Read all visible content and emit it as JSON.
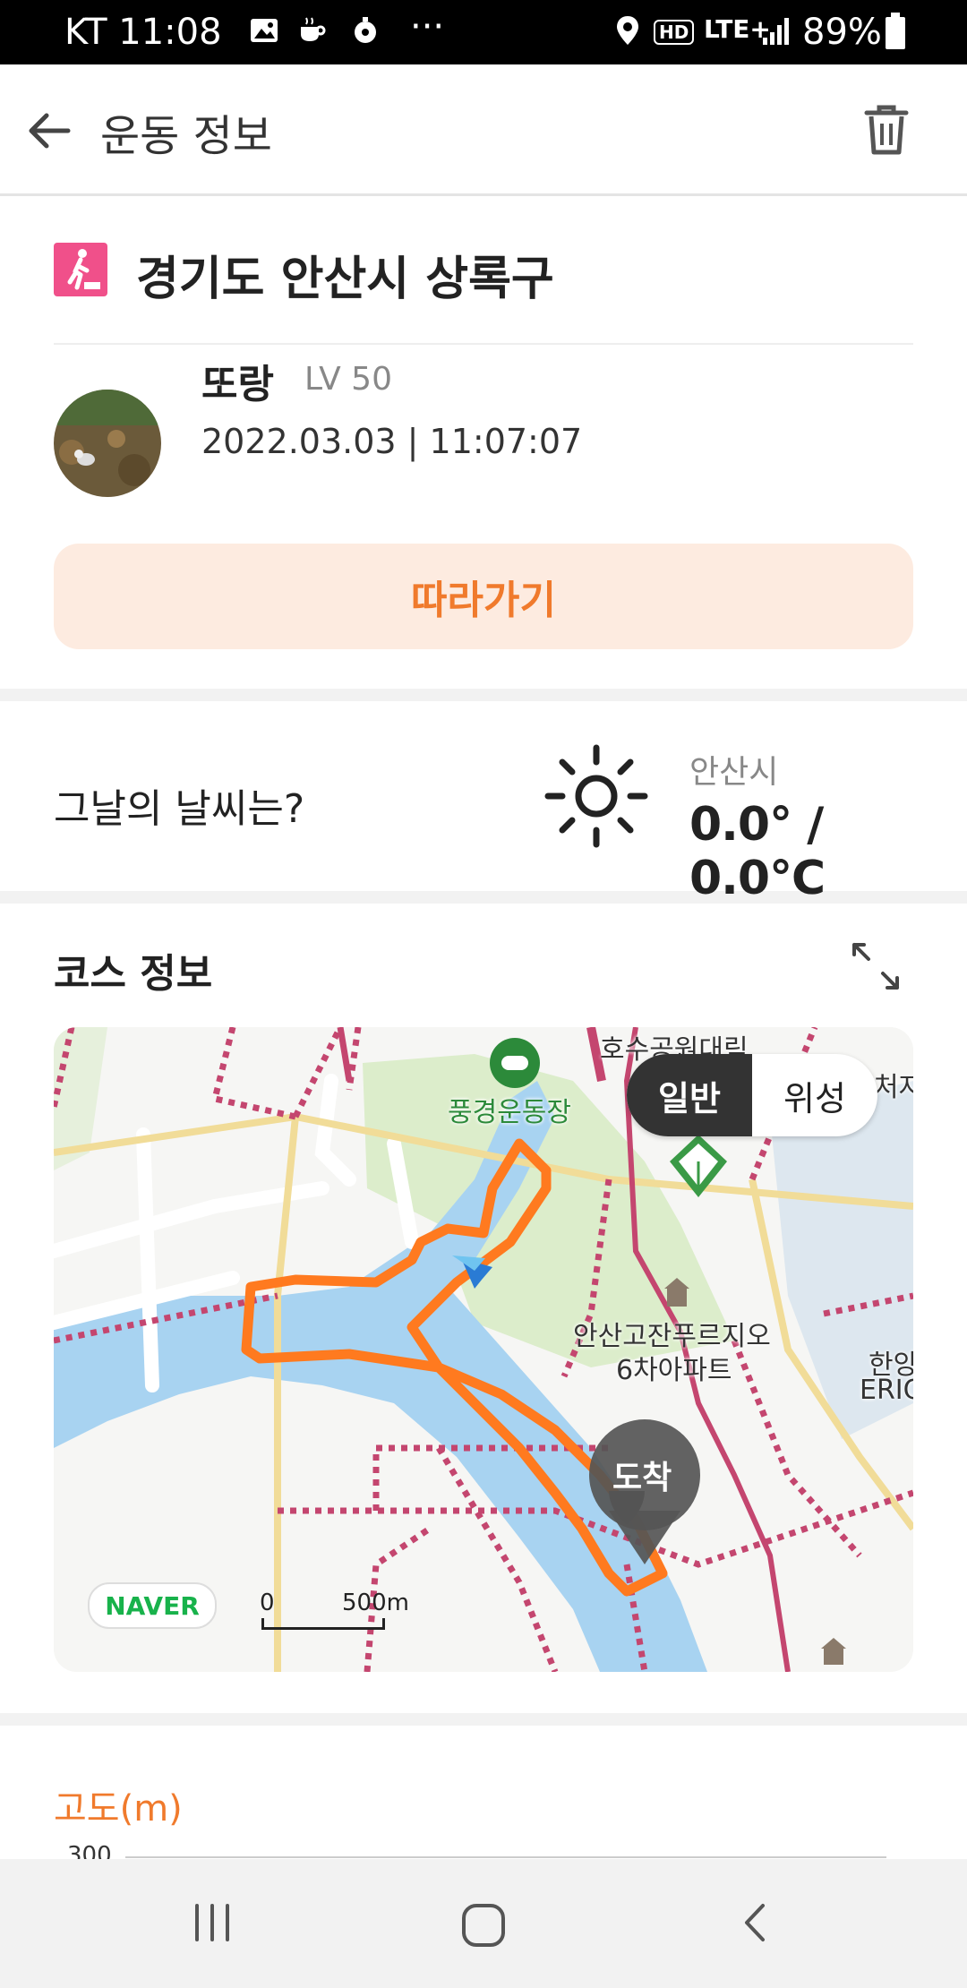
{
  "status_bar": {
    "carrier_time": "KT 11:08",
    "more": "···",
    "hd": "HD",
    "network": "LTE+",
    "battery": "89%"
  },
  "app_bar": {
    "title": "운동 정보"
  },
  "summary": {
    "location": "경기도 안산시 상록구",
    "user_name": "또랑",
    "user_level": "LV 50",
    "datetime": "2022.03.03 | 11:07:07",
    "follow_label": "따라가기"
  },
  "weather": {
    "question": "그날의 날씨는?",
    "city": "안산시",
    "temperature": "0.0° / 0.0℃"
  },
  "course": {
    "title": "코스 정보",
    "map": {
      "toggle_normal": "일반",
      "toggle_satellite": "위성",
      "labels": {
        "stadium": "풍경운동장",
        "park_top": "호수공원대림",
        "apartment_line1": "안산고잔푸르지오",
        "apartment_line2": "6차아파트",
        "right_edge_top": "한양",
        "right_edge_bottom": "ERIC",
        "right_top": "처자",
        "arrival_marker": "도착"
      },
      "logo": "NAVER",
      "scale_zero": "0",
      "scale_distance": "500m"
    }
  },
  "elevation": {
    "label": "고도(m)",
    "tick_top": "300"
  },
  "colors": {
    "accent": "#f07a2c",
    "accent_light": "#fdebe0",
    "route": "#ff7a1f",
    "water": "#a8d3f1",
    "park": "#d9ecc9"
  }
}
